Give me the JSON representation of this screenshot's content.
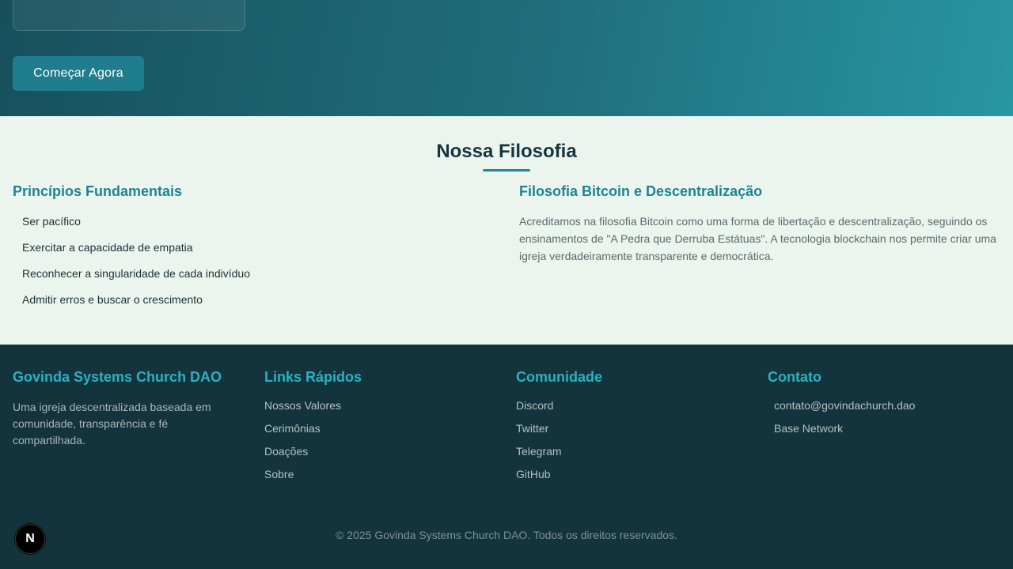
{
  "hero": {
    "cta_label": "Começar Agora"
  },
  "philosophy": {
    "title": "Nossa Filosofia",
    "principles_title": "Princípios Fundamentais",
    "principles": [
      "Ser pacífico",
      "Exercitar a capacidade de empatia",
      "Reconhecer a singularidade de cada indivíduo",
      "Admitir erros e buscar o crescimento"
    ],
    "bitcoin_title": "Filosofia Bitcoin e Descentralização",
    "bitcoin_text": "Acreditamos na filosofia Bitcoin como uma forma de libertação e descentralização, seguindo os ensinamentos de \"A Pedra que Derruba Estátuas\". A tecnologia blockchain nos permite criar uma igreja verdadeiramente transparente e democrática."
  },
  "footer": {
    "brand_title": "Govinda Systems Church DAO",
    "brand_desc": "Uma igreja descentralizada baseada em comunidade, transparência e fé compartilhada.",
    "quick_links_title": "Links Rápidos",
    "quick_links": [
      "Nossos Valores",
      "Cerimônias",
      "Doações",
      "Sobre"
    ],
    "community_title": "Comunidade",
    "community_links": [
      "Discord",
      "Twitter",
      "Telegram",
      "GitHub"
    ],
    "contact_title": "Contato",
    "contact_items": [
      "contato@govindachurch.dao",
      "Base Network"
    ],
    "copyright": "© 2025 Govinda Systems Church DAO. Todos os direitos reservados."
  },
  "badge": {
    "letter": "N",
    "icon": "nextjs-icon"
  }
}
